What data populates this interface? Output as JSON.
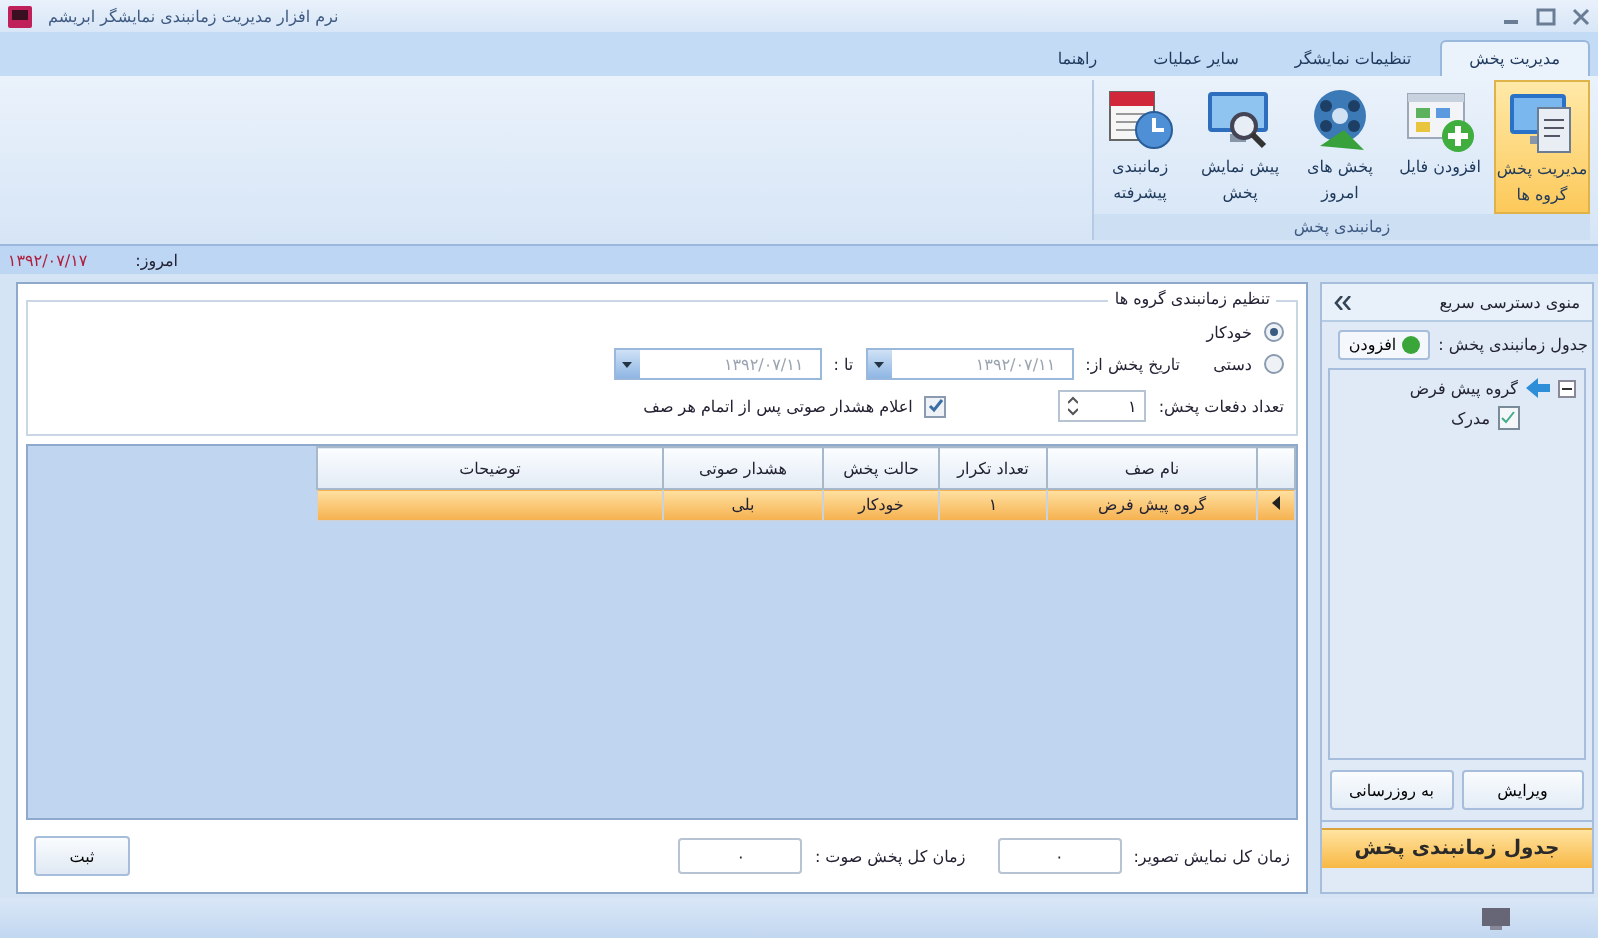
{
  "window": {
    "title": "نرم افزار مدیریت زمانبندی نمایشگر ابریشم"
  },
  "ribbon": {
    "tabs": [
      {
        "label": "مدیریت پخش",
        "selected": true
      },
      {
        "label": "تنظیمات نمایشگر",
        "selected": false
      },
      {
        "label": "سایر عملیات",
        "selected": false
      },
      {
        "label": "راهنما",
        "selected": false
      }
    ],
    "group_label": "زمانبندی پخش",
    "buttons": [
      {
        "lines": [
          "مدیریت پخش",
          "گروه ها"
        ],
        "selected": true
      },
      {
        "lines": [
          "افزودن فایل"
        ],
        "selected": false
      },
      {
        "lines": [
          "پخش های",
          "امروز"
        ],
        "selected": false
      },
      {
        "lines": [
          "پیش نمایش",
          "پخش"
        ],
        "selected": false
      },
      {
        "lines": [
          "زمانبندی",
          "پیشرفته"
        ],
        "selected": false
      }
    ]
  },
  "today": {
    "label": "امروز:",
    "date": "۱۳۹۲/۰۷/۱۷"
  },
  "schedule": {
    "title": "تنظیم زمانبندی گروه ها",
    "modes": [
      {
        "label": "خودکار",
        "selected": true
      },
      {
        "label": "دستی",
        "selected": false
      }
    ],
    "from_label": "تاریخ پخش از:",
    "from_date": "۱۳۹۲/۰۷/۱۱",
    "to_label": "تا :",
    "to_date": "۱۳۹۲/۰۷/۱۱",
    "dates_disabled": true,
    "count_label": "تعداد دفعات پخش:",
    "count": "۱",
    "alarm": {
      "label": "اعلام هشدار صوتی پس از اتمام هر صف",
      "checked": true
    }
  },
  "table": {
    "columns": [
      "نام صف",
      "تعداد تکرار",
      "حالت پخش",
      "هشدار صوتی",
      "توضیحات"
    ],
    "rows": [
      {
        "cells": [
          "گروه پیش فرض",
          "۱",
          "خودکار",
          "بلی"
        ],
        "selected": true
      }
    ]
  },
  "footer": {
    "image_time_label": "زمان کل نمایش تصویر:",
    "image_time": "۰",
    "audio_time_label": "زمان کل پخش صوت :",
    "audio_time": "۰",
    "submit": "ثبت"
  },
  "sidebar": {
    "title": "منوی دسترسی سریع",
    "table_label": "جدول زمانبندی پخش :",
    "add_button": "افزودن",
    "tree": [
      {
        "label": "گروه پیش فرض",
        "expanded": true,
        "children": [
          {
            "label": "مدرک"
          }
        ]
      }
    ],
    "buttons": [
      "ویرایش",
      "به روزرسانی"
    ],
    "footer_button": "جدول زمانبندی پخش"
  }
}
